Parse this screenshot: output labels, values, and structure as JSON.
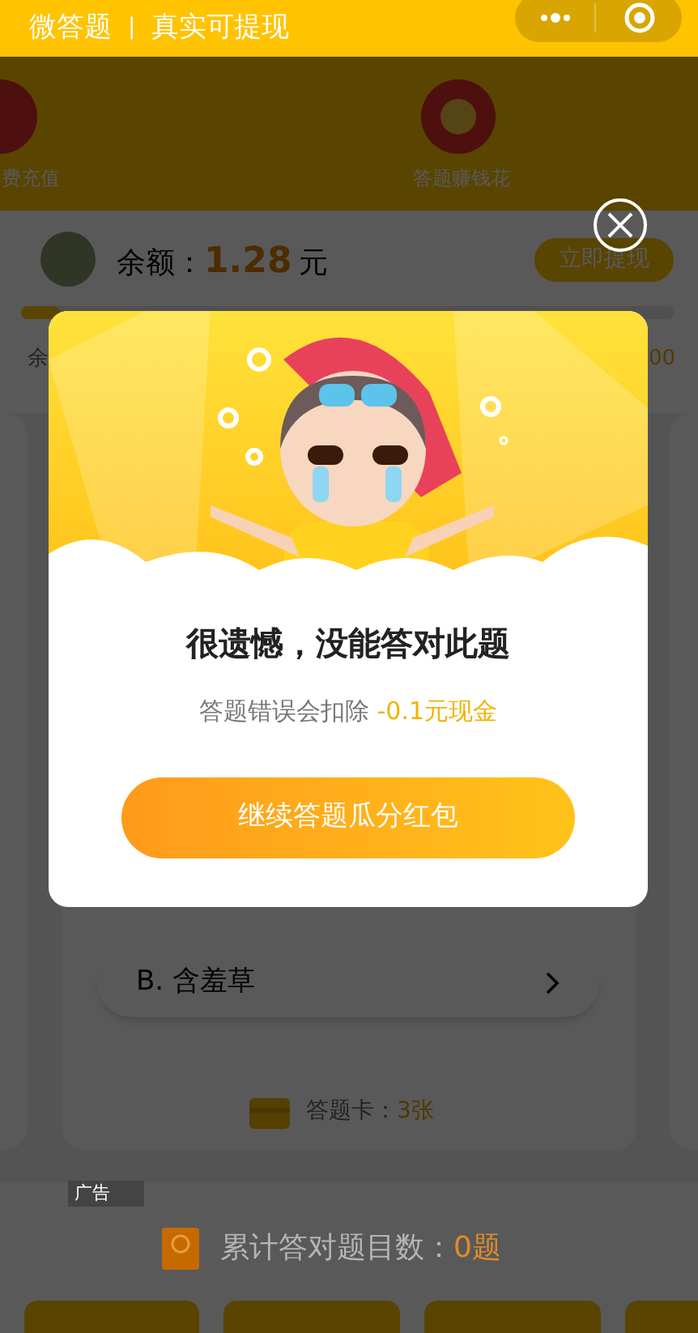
{
  "top_bar": {
    "title": "微答题",
    "separator": "|",
    "subtitle": "真实可提现"
  },
  "banner": {
    "items": [
      {
        "label": "费充值",
        "kind": "coin-partial"
      },
      {
        "label": "答题赚钱花",
        "kind": "coin"
      }
    ]
  },
  "balance": {
    "label": "余额：",
    "amount": "1.28",
    "unit": "元",
    "withdraw_button": "立即提现",
    "progress": {
      "level": 0.06,
      "left_text": "余",
      "right_text": "00"
    }
  },
  "question": {
    "options": [
      {
        "label": "B. 含羞草"
      }
    ],
    "card_label": "答题卡：",
    "card_count": "3张"
  },
  "ad": {
    "tag": "广告",
    "stat_label": "累计答对题目数：",
    "stat_value": "0题"
  },
  "dialog": {
    "title": "很遗憾，没能答对此题",
    "message": "答题错误会扣除 ",
    "penalty": "-0.1元现金",
    "button": "继续答题瓜分红包"
  }
}
